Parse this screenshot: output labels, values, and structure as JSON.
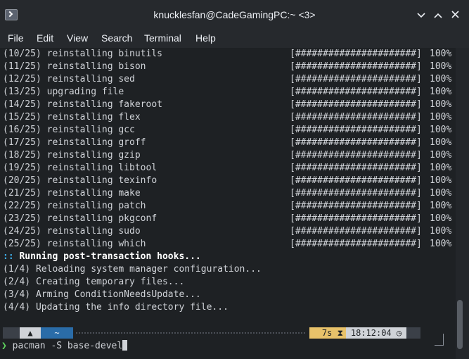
{
  "window": {
    "title": "knucklesfan@CadeGamingPC:~ <3>",
    "min_icon": "chevron-down",
    "max_icon": "chevron-up",
    "close_icon": "close"
  },
  "menu": [
    "File",
    "Edit",
    "View",
    "Search",
    "Terminal",
    "Help"
  ],
  "output_lines": [
    {
      "text": "(10/25) reinstalling binutils",
      "bar": "[######################]",
      "pct": "100%"
    },
    {
      "text": "(11/25) reinstalling bison",
      "bar": "[######################]",
      "pct": "100%"
    },
    {
      "text": "(12/25) reinstalling sed",
      "bar": "[######################]",
      "pct": "100%"
    },
    {
      "text": "(13/25) upgrading file",
      "bar": "[######################]",
      "pct": "100%"
    },
    {
      "text": "(14/25) reinstalling fakeroot",
      "bar": "[######################]",
      "pct": "100%"
    },
    {
      "text": "(15/25) reinstalling flex",
      "bar": "[######################]",
      "pct": "100%"
    },
    {
      "text": "(16/25) reinstalling gcc",
      "bar": "[######################]",
      "pct": "100%"
    },
    {
      "text": "(17/25) reinstalling groff",
      "bar": "[######################]",
      "pct": "100%"
    },
    {
      "text": "(18/25) reinstalling gzip",
      "bar": "[######################]",
      "pct": "100%"
    },
    {
      "text": "(19/25) reinstalling libtool",
      "bar": "[######################]",
      "pct": "100%"
    },
    {
      "text": "(20/25) reinstalling texinfo",
      "bar": "[######################]",
      "pct": "100%"
    },
    {
      "text": "(21/25) reinstalling make",
      "bar": "[######################]",
      "pct": "100%"
    },
    {
      "text": "(22/25) reinstalling patch",
      "bar": "[######################]",
      "pct": "100%"
    },
    {
      "text": "(23/25) reinstalling pkgconf",
      "bar": "[######################]",
      "pct": "100%"
    },
    {
      "text": "(24/25) reinstalling sudo",
      "bar": "[######################]",
      "pct": "100%"
    },
    {
      "text": "(25/25) reinstalling which",
      "bar": "[######################]",
      "pct": "100%"
    }
  ],
  "hooks_header": {
    "marker": "::",
    "text": " Running post-transaction hooks..."
  },
  "hook_lines": [
    "(1/4) Reloading system manager configuration...",
    "(2/4) Creating temporary files...",
    "(3/4) Arming ConditionNeedsUpdate...",
    "(4/4) Updating the info directory file..."
  ],
  "prompt": {
    "os_icon": "arch-icon",
    "dir": "~",
    "duration": "7s",
    "time": "18:12:04",
    "caret": "❯",
    "command": "pacman -S base-devel"
  }
}
